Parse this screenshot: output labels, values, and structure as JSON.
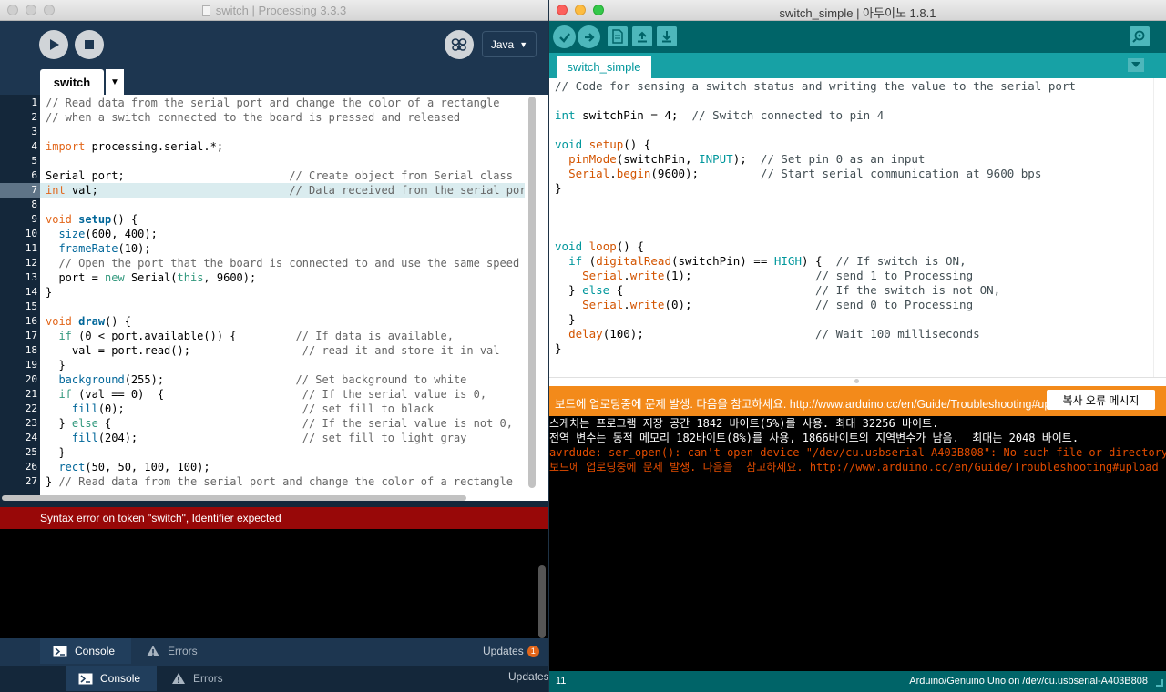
{
  "processing": {
    "title": "switch | Processing 3.3.3",
    "mode": "Java",
    "tab": "switch",
    "line_numbers": [
      "1",
      "2",
      "3",
      "4",
      "5",
      "6",
      "7",
      "8",
      "9",
      "10",
      "11",
      "12",
      "13",
      "14",
      "15",
      "16",
      "17",
      "18",
      "19",
      "20",
      "21",
      "22",
      "23",
      "24",
      "25",
      "26",
      "27"
    ],
    "highlighted_line": 7,
    "error_message": "Syntax error on token \"switch\", Identifier expected",
    "footer_tabs": [
      "Console",
      "Errors"
    ],
    "updates_label": "Updates",
    "updates_count": "1"
  },
  "arduino": {
    "title": "switch_simple | 아두이노 1.8.1",
    "tab": "switch_simple",
    "status_message": "보드에 업로딩중에 문제 발생. 다음을  참고하세요. http://www.arduino.cc/en/Guide/Troubleshooting#upload",
    "copy_button": "복사 오류 메시지",
    "console_lines": [
      {
        "text": "스케치는 프로그램 저장 공간 1842 바이트(5%)를 사용. 최대 32256 바이트.",
        "error": false
      },
      {
        "text": "전역 변수는 동적 메모리 182바이트(8%)를 사용, 1866바이트의 지역변수가 남음.  최대는 2048 바이트.",
        "error": false
      },
      {
        "text": "avrdude: ser_open(): can't open device \"/dev/cu.usbserial-A403B808\": No such file or directory",
        "error": true
      },
      {
        "text": "보드에 업로딩중에 문제 발생. 다음을  참고하세요. http://www.arduino.cc/en/Guide/Troubleshooting#upload",
        "error": true
      }
    ],
    "line_number": "11",
    "board_info": "Arduino/Genuino Uno on /dev/cu.usbserial-A403B808"
  },
  "colors": {
    "processing_bg": "#1d3650",
    "processing_error": "#980808",
    "arduino_teal": "#006468",
    "arduino_tab": "#17a1a5",
    "arduino_status": "#f38a1a"
  }
}
